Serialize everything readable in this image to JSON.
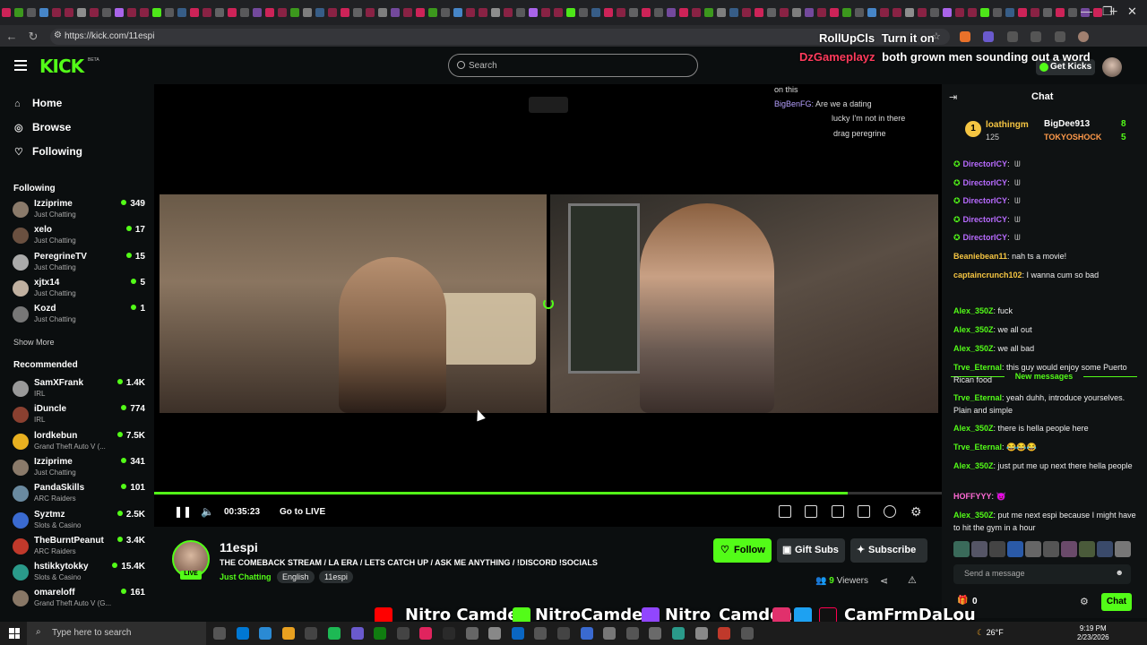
{
  "browser": {
    "url": "https://kick.com/11espi"
  },
  "header": {
    "search_placeholder": "Search",
    "get_kicks": "Get Kicks",
    "logo": "KICK",
    "beta": "BETA"
  },
  "overlay_chat": [
    {
      "user": "RollUpCls",
      "text": "Turn it on",
      "color": "#ffffff"
    },
    {
      "user": "DzGameplayz",
      "text": "both grown men sounding out a word",
      "color": "#ff3b5c"
    }
  ],
  "sidebar": {
    "nav": [
      {
        "label": "Home",
        "icon": "home-icon"
      },
      {
        "label": "Browse",
        "icon": "compass-icon"
      },
      {
        "label": "Following",
        "icon": "heart-icon"
      }
    ],
    "following_title": "Following",
    "following": [
      {
        "name": "Izziprime",
        "category": "Just Chatting",
        "viewers": "349"
      },
      {
        "name": "xelo",
        "category": "Just Chatting",
        "viewers": "17"
      },
      {
        "name": "PeregrineTV",
        "category": "Just Chatting",
        "viewers": "15"
      },
      {
        "name": "xjtx14",
        "category": "Just Chatting",
        "viewers": "5"
      },
      {
        "name": "Kozd",
        "category": "Just Chatting",
        "viewers": "1"
      }
    ],
    "show_more": "Show More",
    "recommended_title": "Recommended",
    "recommended": [
      {
        "name": "SamXFrank",
        "category": "IRL",
        "viewers": "1.4K"
      },
      {
        "name": "iDuncle",
        "category": "IRL",
        "viewers": "774"
      },
      {
        "name": "lordkebun",
        "category": "Grand Theft Auto V (...",
        "viewers": "7.5K"
      },
      {
        "name": "Izziprime",
        "category": "Just Chatting",
        "viewers": "341"
      },
      {
        "name": "PandaSkills",
        "category": "ARC Raiders",
        "viewers": "101"
      },
      {
        "name": "Syztmz",
        "category": "Slots & Casino",
        "viewers": "2.5K"
      },
      {
        "name": "TheBurntPeanut",
        "category": "ARC Raiders",
        "viewers": "3.4K"
      },
      {
        "name": "hstikkytokky",
        "category": "Slots & Casino",
        "viewers": "15.4K"
      },
      {
        "name": "omareloff",
        "category": "Grand Theft Auto V (G...",
        "viewers": "161"
      }
    ]
  },
  "video": {
    "chat_lines": [
      {
        "user": "",
        "text": "on this"
      },
      {
        "user": "BigBenFG:",
        "text": "Are we a dating"
      },
      {
        "user": "",
        "text": "lucky I'm not in there"
      },
      {
        "user": "",
        "text": "drag peregrine"
      }
    ],
    "timecode": "00:35:23",
    "go_live": "Go to LIVE",
    "progress": 0.88
  },
  "stream": {
    "streamer": "11espi",
    "live": "LIVE",
    "title": "THE COMEBACK STREAM / LA ERA / LETS CATCH UP / ASK ME ANYTHING / !DISCORD !SOCIALS",
    "category": "Just Chatting",
    "tags": [
      "English",
      "11espi"
    ],
    "follow": "Follow",
    "gift_subs": "Gift Subs",
    "subscribe": "Subscribe",
    "viewers": "9",
    "viewers_label": "Viewers"
  },
  "chat": {
    "title": "Chat",
    "leaderboard": [
      {
        "name": "loathingm",
        "count": "125"
      },
      {
        "name": "BigDee913",
        "count": "8"
      },
      {
        "name": "TOKYOSHOCK",
        "count": "5"
      }
    ],
    "messages": [
      {
        "user": "DirectorICY",
        "text": "",
        "color": "#b86bff"
      },
      {
        "user": "DirectorICY",
        "text": "",
        "color": "#b86bff"
      },
      {
        "user": "DirectorICY",
        "text": "",
        "color": "#b86bff"
      },
      {
        "user": "DirectorICY",
        "text": "",
        "color": "#b86bff"
      },
      {
        "user": "DirectorICY",
        "text": "",
        "color": "#b86bff"
      },
      {
        "user": "Beaniebean11",
        "text": "nah ts a movie!",
        "color": "#f5c542"
      },
      {
        "user": "captaincrunch102",
        "text": "I wanna cum so bad",
        "color": "#f5c542"
      }
    ],
    "new_messages": "New messages",
    "messages2": [
      {
        "user": "Alex_350Z",
        "text": "fuck",
        "color": "#53fc18"
      },
      {
        "user": "Alex_350Z",
        "text": "we all out",
        "color": "#53fc18"
      },
      {
        "user": "Alex_350Z",
        "text": "we all bad",
        "color": "#53fc18"
      },
      {
        "user": "Trve_Eternal",
        "text": "this guy would enjoy some Puerto Rican food",
        "color": "#53fc18"
      },
      {
        "user": "Trve_Eternal",
        "text": "yeah duhh, introduce yourselves. Plain and simple",
        "color": "#53fc18"
      },
      {
        "user": "Alex_350Z",
        "text": "there is hella people here",
        "color": "#53fc18"
      },
      {
        "user": "Trve_Eternal",
        "text": "😂😂😂",
        "color": "#53fc18"
      },
      {
        "user": "Alex_350Z",
        "text": "just put me up next there hella people",
        "color": "#53fc18"
      },
      {
        "user": "HOFFYYY",
        "text": "😈",
        "color": "#ff6ad5"
      },
      {
        "user": "Alex_350Z",
        "text": "put me next espi because I might have to hit the gym in a hour",
        "color": "#53fc18"
      }
    ],
    "send_placeholder": "Send a message",
    "points": "0",
    "chat_button": "Chat"
  },
  "social_overlay": {
    "youtube": "Nitro Camden",
    "kick": "NitroCamden",
    "twitch": "Nitro_Camden",
    "handle": "CamFrmDaLou"
  },
  "taskbar": {
    "search": "Type here to search",
    "temp": "26°F",
    "time": "9:19 PM",
    "date": "2/23/2026"
  }
}
